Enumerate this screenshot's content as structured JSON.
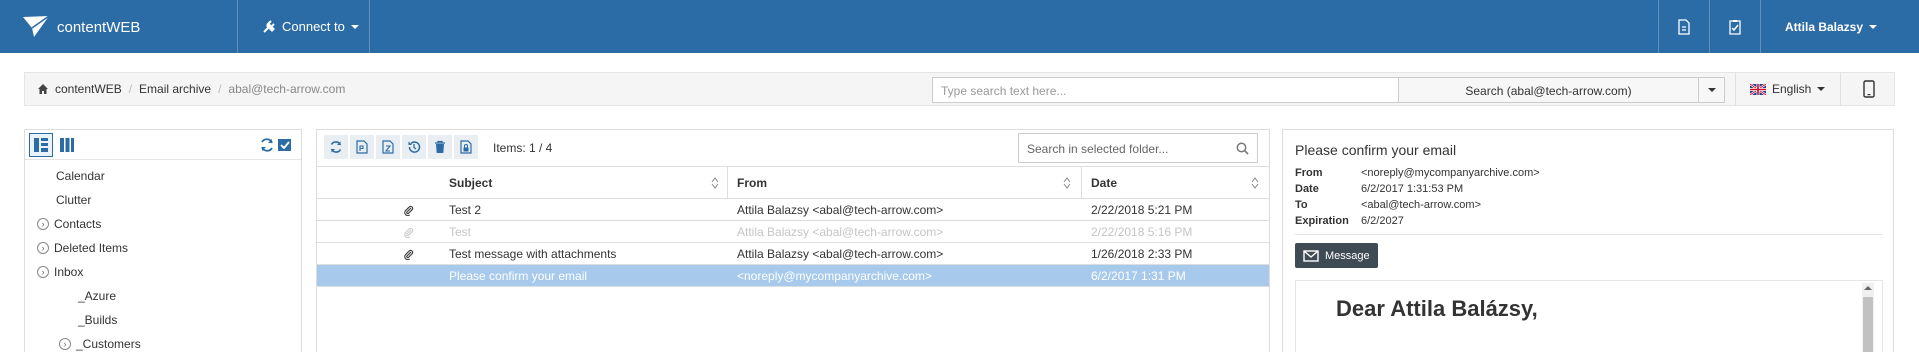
{
  "navbar": {
    "brand": "contentWEB",
    "connect_label": "Connect to",
    "user_name": "Attila Balazsy",
    "icons": [
      "document-icon",
      "clipboard-check-icon"
    ]
  },
  "breadcrumb": {
    "items": [
      "contentWEB",
      "Email archive",
      "abal@tech-arrow.com"
    ]
  },
  "search": {
    "placeholder": "Type search text here...",
    "button_label": "Search (abal@tech-arrow.com)"
  },
  "language": "English",
  "folders": {
    "items": [
      {
        "label": "Calendar",
        "expandable": false
      },
      {
        "label": "Clutter",
        "expandable": false
      },
      {
        "label": "Contacts",
        "expandable": true
      },
      {
        "label": "Deleted Items",
        "expandable": true
      },
      {
        "label": "Inbox",
        "expandable": true
      },
      {
        "label": "_Azure",
        "expandable": false
      },
      {
        "label": "_Builds",
        "expandable": false
      },
      {
        "label": "_Customers",
        "expandable": true
      }
    ]
  },
  "maillist": {
    "items_count": "Items: 1 / 4",
    "folder_search_placeholder": "Search in selected folder...",
    "columns": {
      "subject": "Subject",
      "from": "From",
      "date": "Date"
    },
    "rows": [
      {
        "attachment": true,
        "subject": "Test 2",
        "from": "Attila Balazsy <abal@tech-arrow.com>",
        "date": "2/22/2018 5:21 PM",
        "state": "normal"
      },
      {
        "attachment": true,
        "subject": "Test",
        "from": "Attila Balazsy <abal@tech-arrow.com>",
        "date": "2/22/2018 5:16 PM",
        "state": "dim"
      },
      {
        "attachment": true,
        "subject": "Test message with attachments",
        "from": "Attila Balazsy <abal@tech-arrow.com>",
        "date": "1/26/2018 2:33 PM",
        "state": "normal"
      },
      {
        "attachment": false,
        "subject": "Please confirm your email",
        "from": "<noreply@mycompanyarchive.com>",
        "date": "6/2/2017 1:31 PM",
        "state": "selected"
      }
    ]
  },
  "preview": {
    "title": "Please confirm your email",
    "fields": [
      {
        "key": "From",
        "value": "<noreply@mycompanyarchive.com>"
      },
      {
        "key": "Date",
        "value": "6/2/2017 1:31:53 PM"
      },
      {
        "key": "To",
        "value": "<abal@tech-arrow.com>"
      },
      {
        "key": "Expiration",
        "value": "6/2/2027"
      }
    ],
    "message_button": "Message",
    "greeting": "Dear Attila Balázsy,"
  },
  "colors": {
    "navbar": "#2c6ca6",
    "selected_row": "#a7c9ec",
    "message_button": "#3e4a54"
  }
}
